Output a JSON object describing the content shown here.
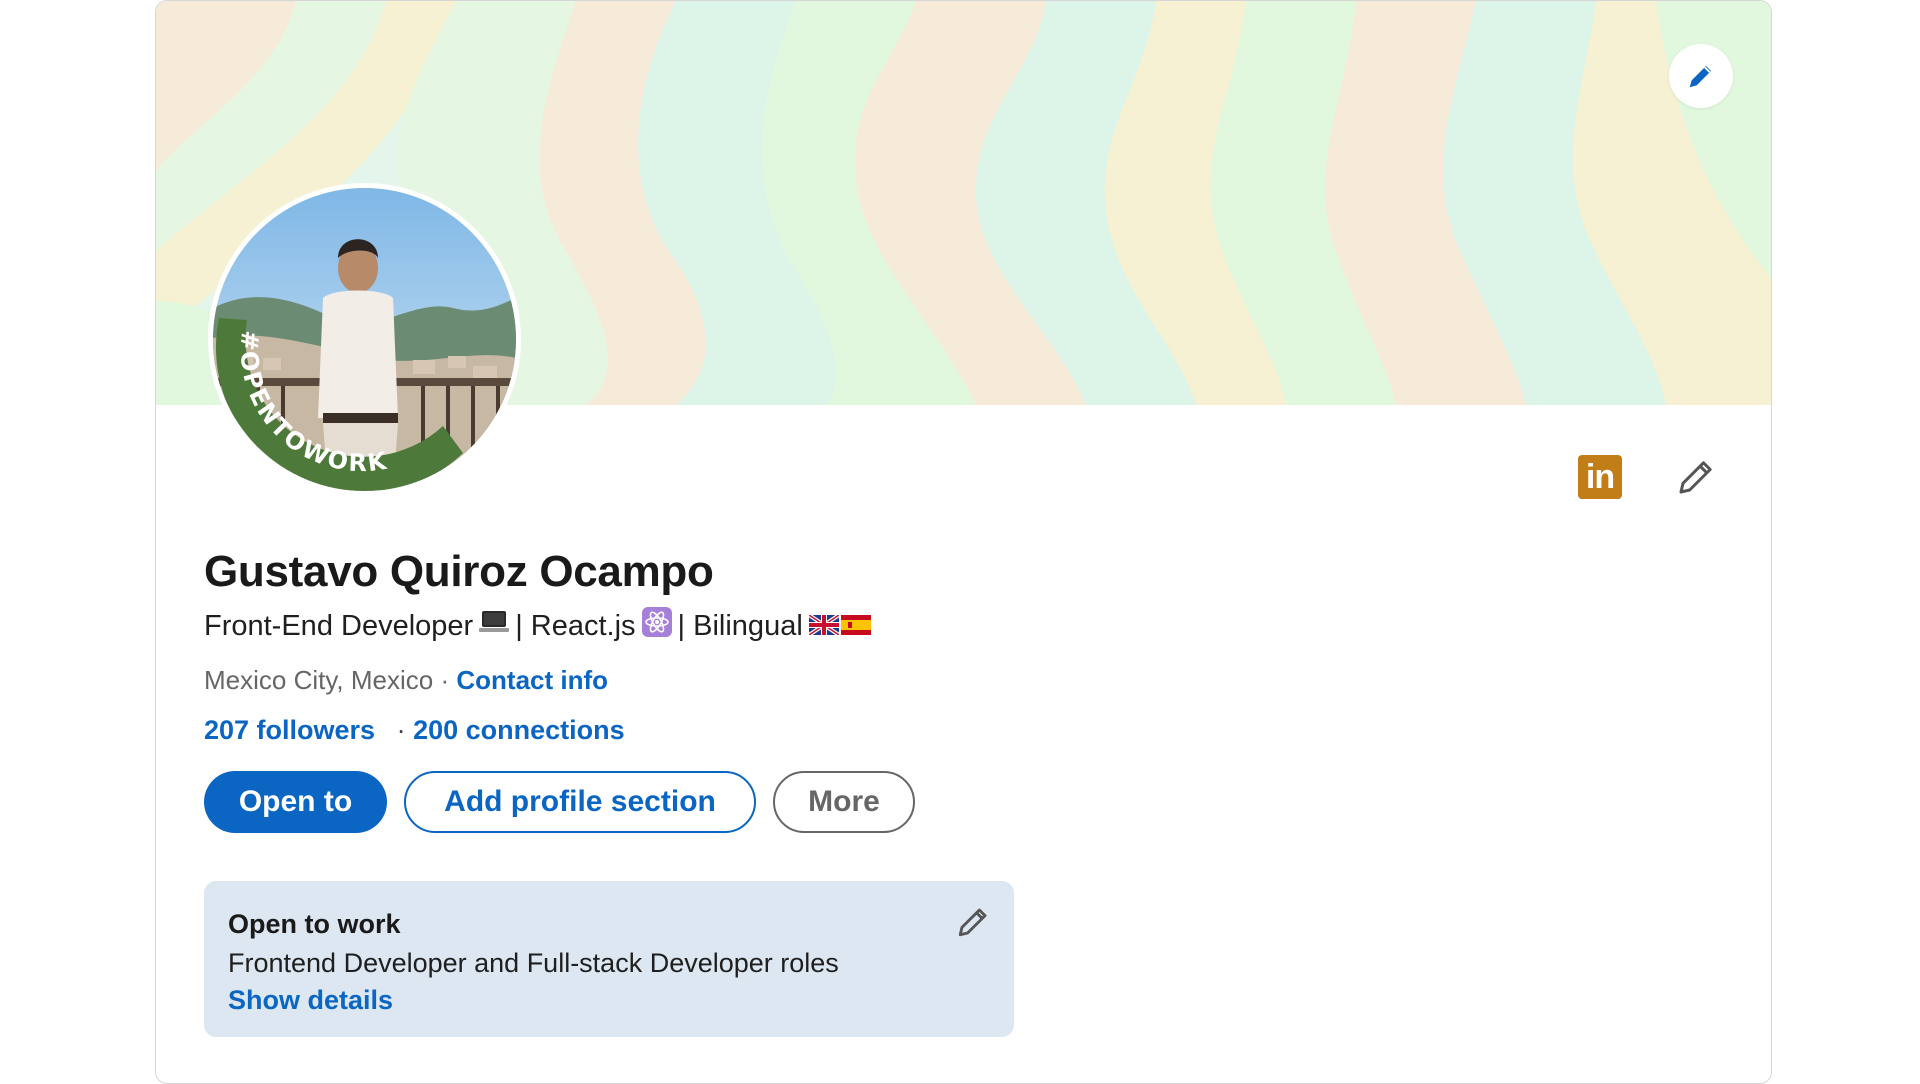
{
  "profile": {
    "name": "Gustavo Quiroz Ocampo",
    "headline": {
      "part1": "Front-End Developer",
      "part2": "| React.js",
      "part3": "| Bilingual",
      "emoji_laptop": "laptop-icon",
      "emoji_react": "atom-icon",
      "emoji_flags": [
        "uk-flag-icon",
        "spain-flag-icon"
      ]
    },
    "location": "Mexico City, Mexico",
    "location_separator": "·",
    "contact_info": "Contact info",
    "followers": "207 followers",
    "connections_separator": "·",
    "connections": "200 connections",
    "avatar_badge": "#OPENTOWORK"
  },
  "actions": {
    "open_to": "Open to",
    "add_section": "Add profile section",
    "more": "More"
  },
  "open_to_work": {
    "title": "Open to work",
    "description": "Frontend Developer and Full-stack Developer roles",
    "show_details": "Show details"
  },
  "icons": {
    "cover_edit": "pencil-icon",
    "linkedin": "linkedin-icon",
    "intro_edit": "pencil-icon",
    "otw_edit": "pencil-icon"
  },
  "colors": {
    "brand_blue": "#0a66c2",
    "open_to_work_green": "#4d7a3a",
    "otw_box_bg": "#dde7f1",
    "linkedin_badge": "#c37d16"
  }
}
